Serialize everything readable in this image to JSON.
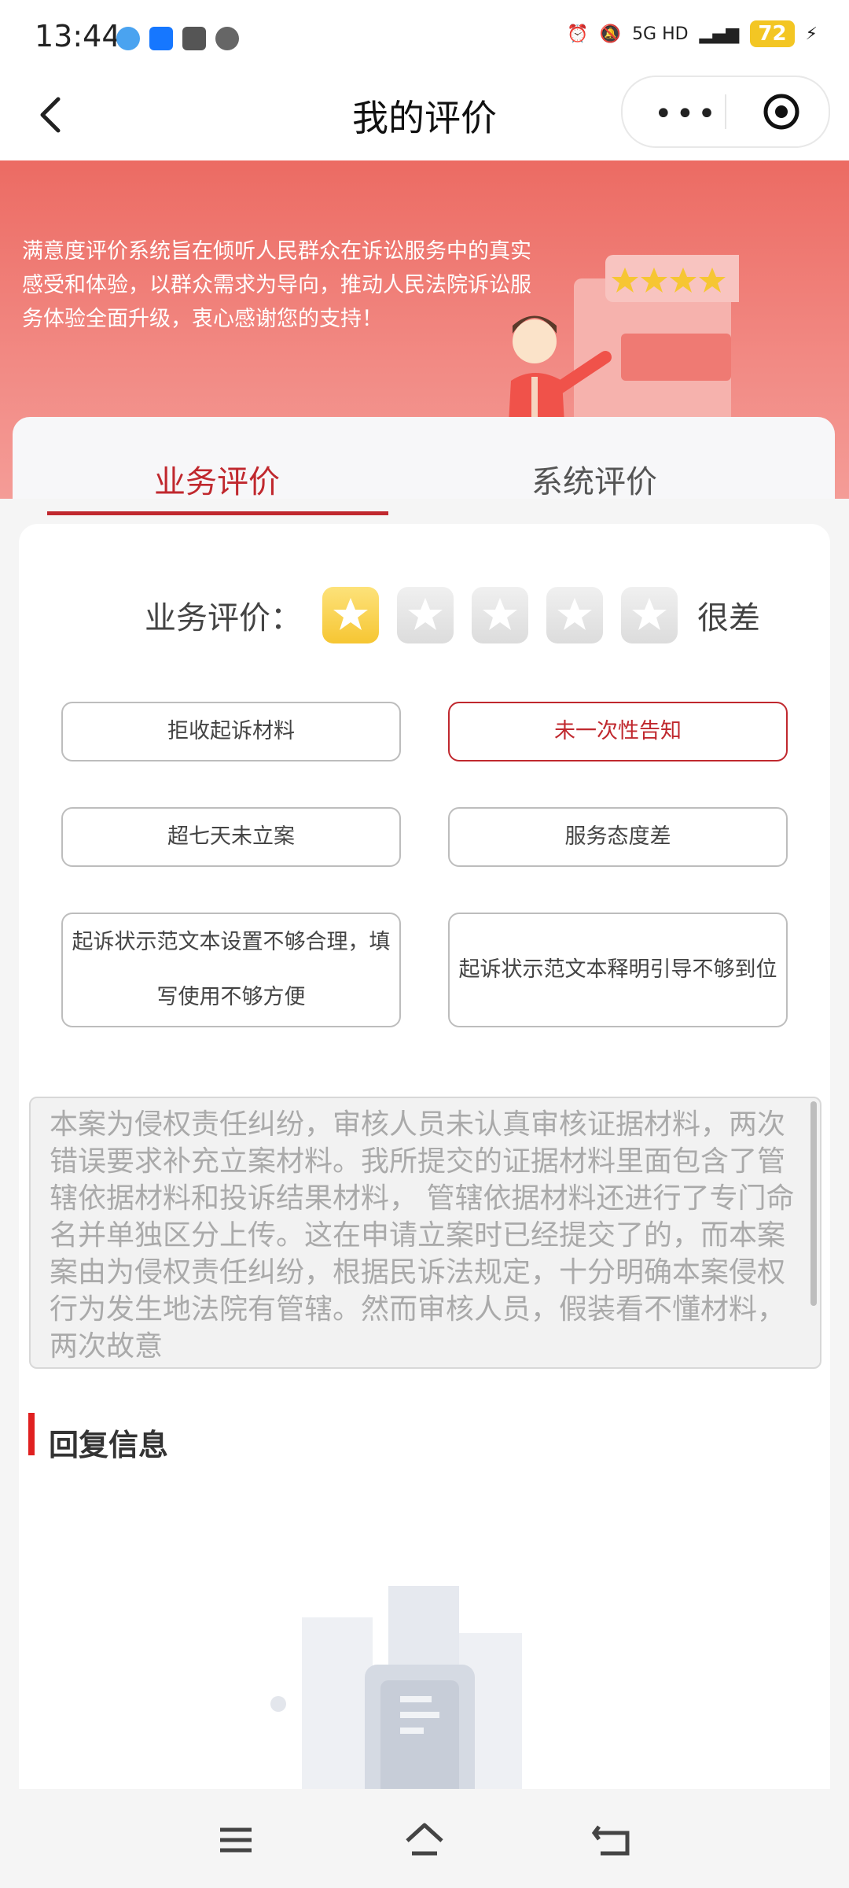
{
  "status_bar": {
    "time": "13:44",
    "network": "5G HD",
    "battery": "72",
    "notification_icons": [
      "qq-icon",
      "alipay-icon",
      "toutiao-icon",
      "message-icon"
    ]
  },
  "nav": {
    "title": "我的评价",
    "more_label": "•••"
  },
  "banner": {
    "text": "满意度评价系统旨在倾听人民群众在诉讼服务中的真实感受和体验，以群众需求为导向，推动人民法院诉讼服务体验全面升级，衷心感谢您的支持！"
  },
  "tabs": [
    {
      "label": "业务评价",
      "active": true
    },
    {
      "label": "系统评价",
      "active": false
    }
  ],
  "rating": {
    "label": "业务评价：",
    "stars_selected": 1,
    "stars_total": 5,
    "text": "很差"
  },
  "tags": [
    {
      "label": "拒收起诉材料",
      "selected": false
    },
    {
      "label": "未一次性告知",
      "selected": true
    },
    {
      "label": "超七天未立案",
      "selected": false
    },
    {
      "label": "服务态度差",
      "selected": false
    },
    {
      "label": "起诉状示范文本设置不够合理，填写使用不够方便",
      "selected": false
    },
    {
      "label": "起诉状示范文本释明引导不够到位",
      "selected": false
    }
  ],
  "comment": {
    "text": "本案为侵权责任纠纷，审核人员未认真审核证据材料，两次错误要求补充立案材料。我所提交的证据材料里面包含了管辖依据材料和投诉结果材料， 管辖依据材料还进行了专门命名并单独区分上传。这在申请立案时已经提交了的，而本案案由为侵权责任纠纷，根据民诉法规定，十分明确本案侵权行为发生地法院有管辖。然而审核人员，假装看不懂材料，两次故意"
  },
  "reply": {
    "title": "回复信息"
  },
  "colors": {
    "accent": "#c0282e",
    "banner": "#ec6b63",
    "star_on": "#f6c633"
  }
}
